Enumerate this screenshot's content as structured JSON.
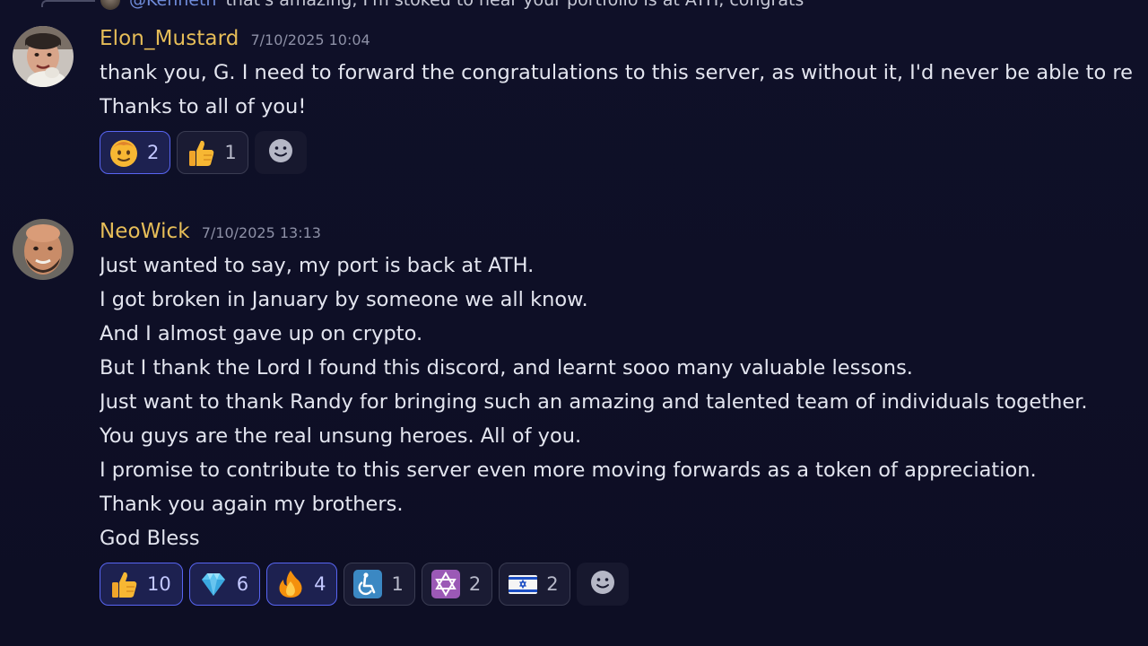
{
  "reply_preview": {
    "mention": "@Kenneth",
    "text": "that's amazing, I'm stoked to hear your portfolio is at ATH, congrats"
  },
  "messages": [
    {
      "username": "Elon_Mustard",
      "timestamp": "7/10/2025 10:04",
      "lines": [
        "thank you, G. I need to forward the congratulations to this server, as without it, I'd never be able to re",
        "Thanks to all of you!"
      ],
      "reactions": [
        {
          "emoji": "smiling-face-icon",
          "count": "2",
          "active": true
        },
        {
          "emoji": "thumbs-up-icon",
          "count": "1",
          "active": false
        }
      ]
    },
    {
      "username": "NeoWick",
      "timestamp": "7/10/2025 13:13",
      "lines": [
        "Just wanted to say, my port is back at ATH.",
        "I got broken in January by someone we all know.",
        "And I almost gave up on crypto.",
        "But I thank the Lord I found this discord, and learnt sooo many valuable lessons.",
        "Just want to thank Randy for bringing such an amazing and talented team of individuals together.",
        "You guys are the real unsung heroes. All of you.",
        "I promise to contribute to this server even more moving forwards as a token of appreciation.",
        "Thank you again my brothers.",
        "God Bless"
      ],
      "reactions": [
        {
          "emoji": "thumbs-up-icon",
          "count": "10",
          "active": true
        },
        {
          "emoji": "gem-icon",
          "count": "6",
          "active": true
        },
        {
          "emoji": "fire-icon",
          "count": "4",
          "active": true
        },
        {
          "emoji": "wheelchair-icon",
          "count": "1",
          "active": false
        },
        {
          "emoji": "star-of-david-icon",
          "count": "2",
          "active": false
        },
        {
          "emoji": "israel-flag-icon",
          "count": "2",
          "active": false
        }
      ]
    }
  ],
  "colors": {
    "background": "#0e0f26",
    "username": "#e6bd58",
    "mention": "#6f8bd9",
    "reaction_active_border": "#5865f2"
  }
}
